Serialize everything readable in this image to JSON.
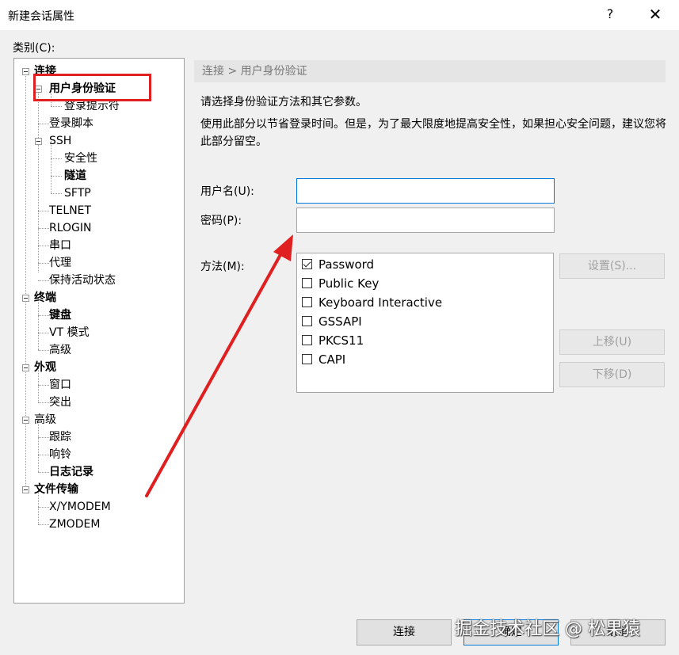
{
  "window": {
    "title": "新建会话属性",
    "help": "?",
    "close": "✕"
  },
  "category_label": "类别(C):",
  "tree": [
    {
      "label": "连接",
      "bold": true
    },
    {
      "label": "用户身份验证",
      "bold": true
    },
    {
      "label": "登录提示符",
      "bold": false
    },
    {
      "label": "登录脚本",
      "bold": false
    },
    {
      "label": "SSH",
      "bold": false
    },
    {
      "label": "安全性",
      "bold": false
    },
    {
      "label": "隧道",
      "bold": true
    },
    {
      "label": "SFTP",
      "bold": false
    },
    {
      "label": "TELNET",
      "bold": false
    },
    {
      "label": "RLOGIN",
      "bold": false
    },
    {
      "label": "串口",
      "bold": false
    },
    {
      "label": "代理",
      "bold": false
    },
    {
      "label": "保持活动状态",
      "bold": false
    },
    {
      "label": "终端",
      "bold": true
    },
    {
      "label": "键盘",
      "bold": true
    },
    {
      "label": "VT 模式",
      "bold": false
    },
    {
      "label": "高级",
      "bold": false
    },
    {
      "label": "外观",
      "bold": true
    },
    {
      "label": "窗口",
      "bold": false
    },
    {
      "label": "突出",
      "bold": false
    },
    {
      "label": "高级",
      "bold": false
    },
    {
      "label": "跟踪",
      "bold": false
    },
    {
      "label": "响铃",
      "bold": false
    },
    {
      "label": "日志记录",
      "bold": true
    },
    {
      "label": "文件传输",
      "bold": true
    },
    {
      "label": "X/YMODEM",
      "bold": false
    },
    {
      "label": "ZMODEM",
      "bold": false
    }
  ],
  "breadcrumb": "连接 > 用户身份验证",
  "description": {
    "line1": "请选择身份验证方法和其它参数。",
    "line2": "使用此部分以节省登录时间。但是，为了最大限度地提高安全性，如果担心安全问题，建议您将此部分留空。"
  },
  "form": {
    "username_label": "用户名(U):",
    "username_value": "",
    "password_label": "密码(P):",
    "password_value": "",
    "method_label": "方法(M):"
  },
  "methods": [
    {
      "label": "Password",
      "checked": true
    },
    {
      "label": "Public Key",
      "checked": false
    },
    {
      "label": "Keyboard Interactive",
      "checked": false
    },
    {
      "label": "GSSAPI",
      "checked": false
    },
    {
      "label": "PKCS11",
      "checked": false
    },
    {
      "label": "CAPI",
      "checked": false
    }
  ],
  "side_buttons": {
    "settings": "设置(S)...",
    "move_up": "上移(U)",
    "move_down": "下移(D)"
  },
  "bottom_buttons": {
    "connect": "连接",
    "ok": "确定",
    "cancel": "取消"
  },
  "watermark": "掘金技术社区 @ 松果猿",
  "colors": {
    "highlight": "#e02020",
    "arrow": "#e02020",
    "focus_border": "#0078d7"
  }
}
